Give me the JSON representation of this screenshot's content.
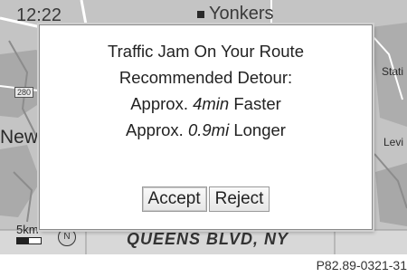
{
  "status": {
    "clock": "12:22"
  },
  "map": {
    "top_place": "Yonkers",
    "left_place": "New",
    "right_place_1": "Stati",
    "right_place_2": "Levi",
    "route_shield": "280",
    "street_name": "QUEENS BLVD, NY",
    "scale": "5km",
    "compass": "N"
  },
  "dialog": {
    "title": "Traffic Jam On Your Route",
    "subtitle": "Recommended Detour:",
    "line1_prefix": "Approx.",
    "line1_value": "4min",
    "line1_suffix": "Faster",
    "line2_prefix": "Approx.",
    "line2_value": "0.9mi",
    "line2_suffix": "Longer",
    "accept_label": "Accept",
    "reject_label": "Reject"
  },
  "figure_ref": "P82.89-0321-31"
}
